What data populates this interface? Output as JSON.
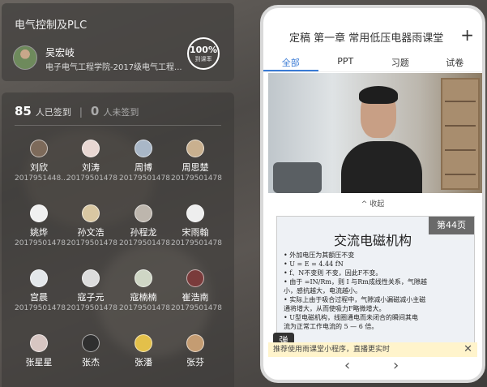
{
  "course": {
    "title": "电气控制及PLC",
    "teacher_name": "吴宏岐",
    "teacher_info": "电子电气工程学院-2017级电气工程...",
    "rate_value": "100%",
    "rate_label": "到课率"
  },
  "attendance": {
    "signed_count": "85",
    "signed_label": "人已签到",
    "separator": "|",
    "unsigned_count": "0",
    "unsigned_label": "人未签到",
    "students": [
      {
        "name": "刘欣",
        "id": "2017951448..."
      },
      {
        "name": "刘涛",
        "id": "20179501478"
      },
      {
        "name": "周博",
        "id": "20179501478"
      },
      {
        "name": "周思楚",
        "id": "20179501478"
      },
      {
        "name": "姚烨",
        "id": "20179501478"
      },
      {
        "name": "孙文浩",
        "id": "20179501478"
      },
      {
        "name": "孙程龙",
        "id": "20179501478"
      },
      {
        "name": "宋雨翰",
        "id": "20179501478"
      },
      {
        "name": "宫晨",
        "id": "20179501478"
      },
      {
        "name": "寇子元",
        "id": "20179501478"
      },
      {
        "name": "寇楠楠",
        "id": "20179501478"
      },
      {
        "name": "崔浩南",
        "id": "20179501478"
      },
      {
        "name": "张星星",
        "id": ""
      },
      {
        "name": "张杰",
        "id": ""
      },
      {
        "name": "张潘",
        "id": ""
      },
      {
        "name": "张芬",
        "id": ""
      }
    ]
  },
  "phone": {
    "title": "定稿 第一章 常用低压电器雨课堂",
    "plus_label": "+",
    "tabs": [
      "全部",
      "PPT",
      "习题",
      "试卷"
    ],
    "collapse_label": "^ 收起",
    "slide": {
      "page_label": "第44页",
      "title": "交流电磁机构",
      "bullets": [
        "• 外加电压为其额压不变",
        "• U = E = 4.44 fN",
        "• f、N不变则  不变，因此F不变。",
        "• 由于  =IN/Rm，则 I 与Rm成线性关系，气隙越",
        "  小，感抗越大，电流越小。",
        "• 实际上由于吸合过程中，气隙减小漏磁减小主磁",
        "  通将增大，从而使吸力F略微增大。",
        "• U型电磁机构，线圈通电而未闭合的瞬间其电",
        "  流为正常工作电流的 5 — 6 倍。"
      ]
    },
    "danmu_label": "弹",
    "banner_text": "推荐使用雨课堂小程序，直播更实时",
    "banner_close": "✕",
    "nav_prev": "‹",
    "nav_next": "›"
  },
  "colors": {
    "accent": "#3a7bd5",
    "banner_bg": "#fff4cc"
  }
}
